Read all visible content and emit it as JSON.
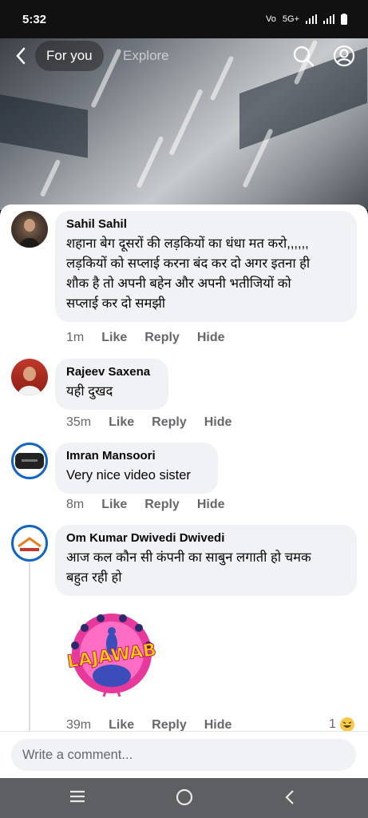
{
  "status_bar": {
    "time": "5:32",
    "network": "5G+"
  },
  "nav": {
    "back_icon": "chevron-left-icon",
    "tabs": [
      "For you",
      "Explore"
    ],
    "search_icon": "search-icon",
    "profile_icon": "profile-icon"
  },
  "comments": [
    {
      "author": "Sahil Sahil",
      "text": "शहाना बेग दूसरों की लड़कियों का धंधा मत करो,,,,,,\nलड़कियों को सप्लाई करना बंद कर दो अगर इतना ही\nशौक है तो अपनी बहेन और अपनी भतीजियों को\nसप्लाई कर दो समझी",
      "time": "1m",
      "like": "Like",
      "reply": "Reply",
      "hide": "Hide"
    },
    {
      "author": "Rajeev Saxena",
      "text": "यही दुखद",
      "time": "35m",
      "like": "Like",
      "reply": "Reply",
      "hide": "Hide"
    },
    {
      "author": "Imran Mansoori",
      "text": "Very nice video sister",
      "time": "8m",
      "like": "Like",
      "reply": "Reply",
      "hide": "Hide"
    },
    {
      "author": "Om Kumar Dwivedi Dwivedi",
      "text": "आज कल कौन सी कंपनी का साबुन लगाती हो चमक\nबहुत रही हो",
      "time": "39m",
      "like": "Like",
      "reply": "Reply",
      "hide": "Hide",
      "sticker": "LAJAWAB",
      "reaction_count": "1",
      "reaction_icon": "laughing-emoji-icon"
    }
  ],
  "composer": {
    "placeholder": "Write a comment..."
  },
  "colors": {
    "bubble": "#f0f2f5",
    "secondary_text": "#65676b",
    "sticker_pink": "#e6399b",
    "sticker_yellow": "#ffd400"
  }
}
